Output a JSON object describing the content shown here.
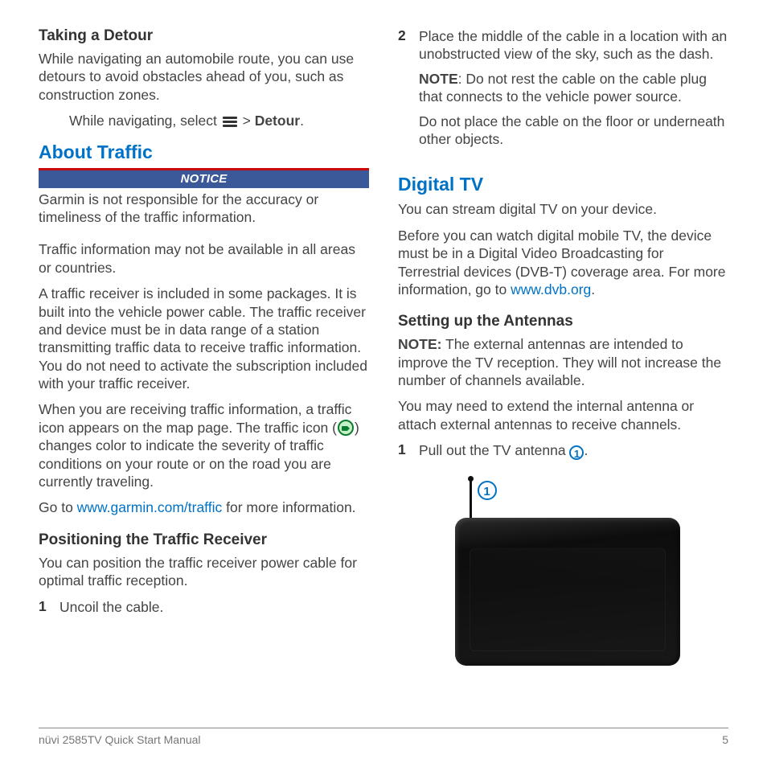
{
  "col1": {
    "detour": {
      "heading": "Taking a Detour",
      "para": "While navigating an automobile route, you can use detours to avoid obstacles ahead of you, such as construction zones.",
      "instr_pre": "While navigating, select ",
      "instr_mid": " > ",
      "instr_bold": "Detour",
      "instr_post": "."
    },
    "traffic": {
      "heading": "About Traffic",
      "notice_label": "NOTICE",
      "notice_text": "Garmin is not responsible for the accuracy or timeliness of the traffic information.",
      "p1": "Traffic information may not be available in all areas or countries.",
      "p2": "A traffic receiver is included in some packages. It is built into the vehicle power cable. The traffic receiver and device must be in data range of a station transmitting traffic data to receive traffic information. You do not need to activate the subscription included with your traffic receiver.",
      "p3_pre": "When you are receiving traffic information, a traffic icon appears on the map page. The traffic icon (",
      "p3_post": ") changes color to indicate the severity of traffic conditions on your route or on the road you are currently traveling.",
      "p4_pre": "Go to ",
      "p4_link": "www.garmin.com/traffic",
      "p4_post": " for more information."
    },
    "receiver": {
      "heading": "Positioning the Traffic Receiver",
      "para": "You can position the traffic receiver power cable for optimal traffic reception.",
      "step1_num": "1",
      "step1_text": "Uncoil the cable."
    }
  },
  "col2": {
    "step2_num": "2",
    "step2_text": "Place the middle of the cable in a location with an unobstructed view of the sky, such as the dash.",
    "step2_note_label": "NOTE",
    "step2_note_text": ": Do not rest the cable on the cable plug that connects to the vehicle power source.",
    "step2_extra": "Do not place the cable on the floor or underneath other objects.",
    "tv": {
      "heading": "Digital TV",
      "p1": "You can stream digital TV on your device.",
      "p2_pre": "Before you can watch digital mobile TV, the device must be in a Digital Video Broadcasting for Terrestrial devices (DVB-T) coverage area. For more information, go to ",
      "p2_link": "www.dvb.org",
      "p2_post": "."
    },
    "antennas": {
      "heading": "Setting up the Antennas",
      "note_label": "NOTE:",
      "note_text": " The external antennas are intended to improve the TV reception. They will not increase the number of channels available.",
      "p2": "You may need to extend the internal antenna or attach external antennas to receive channels.",
      "step1_num": "1",
      "step1_pre": "Pull out the TV antenna ",
      "step1_ref": "➀",
      "step1_post": ".",
      "callout": "➀"
    }
  },
  "footer": {
    "left": "nüvi 2585TV Quick Start Manual",
    "right": "5"
  }
}
